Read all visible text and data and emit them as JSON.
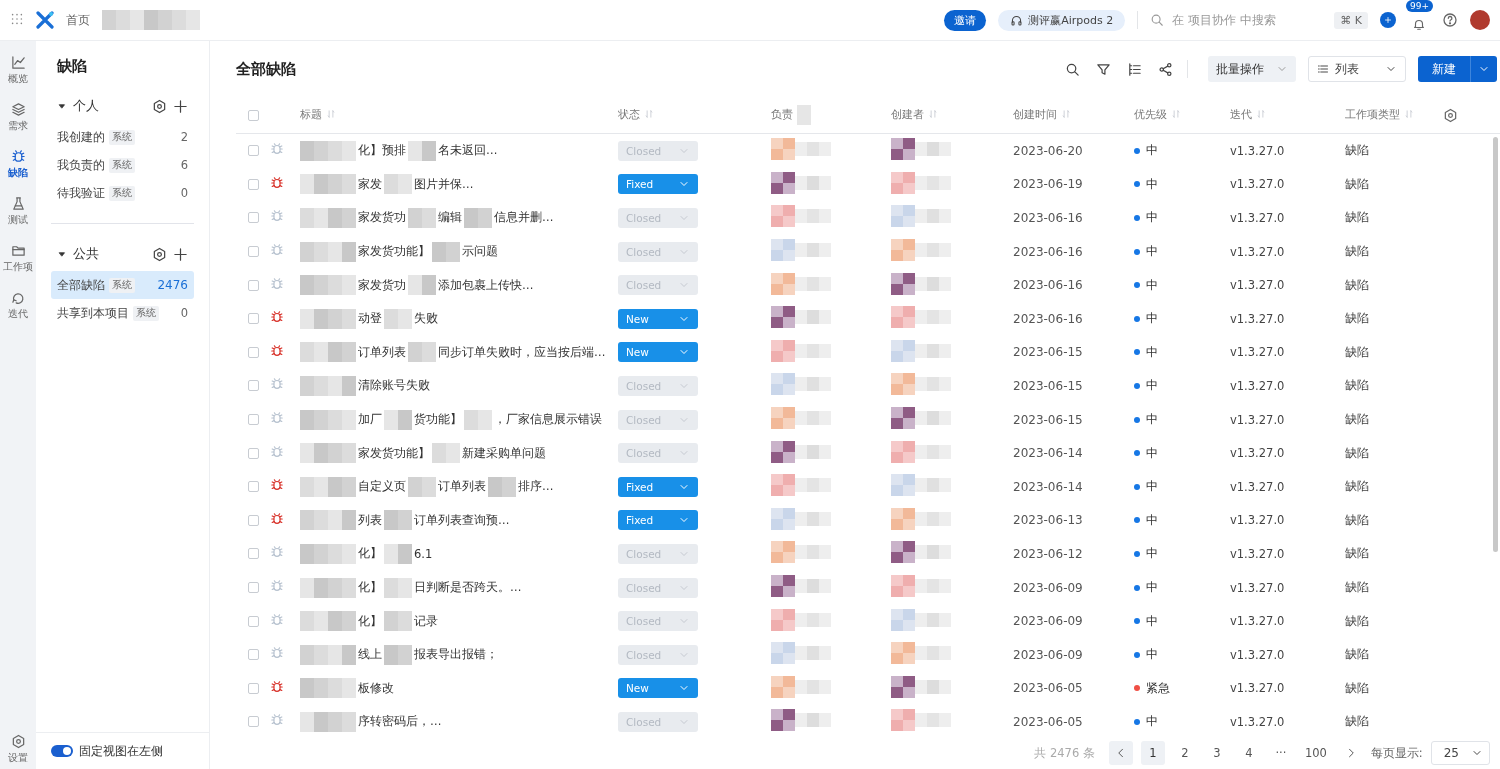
{
  "topbar": {
    "home": "首页",
    "invite": "邀请",
    "promo": "测评赢Airpods 2",
    "search_placeholder": "在 项目协作 中搜索",
    "shortcut": "⌘ K",
    "badge": "99+"
  },
  "rail": {
    "items": [
      {
        "label": "概览",
        "selected": false
      },
      {
        "label": "需求",
        "selected": false
      },
      {
        "label": "缺陷",
        "selected": true
      },
      {
        "label": "测试",
        "selected": false
      },
      {
        "label": "工作项",
        "selected": false
      },
      {
        "label": "迭代",
        "selected": false
      }
    ],
    "settings": "设置"
  },
  "sidebar": {
    "title": "缺陷",
    "sections": [
      {
        "name": "个人",
        "expanded": true,
        "items": [
          {
            "label": "我创建的",
            "tag": "系统",
            "count": "2",
            "selected": false
          },
          {
            "label": "我负责的",
            "tag": "系统",
            "count": "6",
            "selected": false
          },
          {
            "label": "待我验证",
            "tag": "系统",
            "count": "0",
            "selected": false
          }
        ]
      },
      {
        "name": "公共",
        "expanded": true,
        "items": [
          {
            "label": "全部缺陷",
            "tag": "系统",
            "count": "2476",
            "selected": true
          },
          {
            "label": "共享到本项目",
            "tag": "系统",
            "count": "0",
            "selected": false
          }
        ]
      }
    ],
    "pin_toggle": {
      "label": "固定视图在左侧",
      "on": true
    }
  },
  "main": {
    "title": "全部缺陷",
    "select_all_checked": false,
    "batch": "批量操作",
    "view": "列表",
    "create": "新建",
    "columns": [
      "标题",
      "状态",
      "负责",
      "创建者",
      "创建时间",
      "优先级",
      "迭代",
      "工作项类型"
    ],
    "rows": [
      {
        "checked": false,
        "title_parts": [
          "化】预排",
          "名未返回…"
        ],
        "open": false,
        "status": "Closed",
        "created": "2023-06-20",
        "priority": {
          "label": "中",
          "color": "#1677e5"
        },
        "iteration": "v1.3.27.0",
        "type": "缺陷"
      },
      {
        "checked": false,
        "title_parts": [
          "家发",
          "图片并保…"
        ],
        "open": true,
        "status": "Fixed",
        "created": "2023-06-19",
        "priority": {
          "label": "中",
          "color": "#1677e5"
        },
        "iteration": "v1.3.27.0",
        "type": "缺陷"
      },
      {
        "checked": false,
        "title_parts": [
          "家发货功",
          "编辑",
          "信息并删…"
        ],
        "open": false,
        "status": "Closed",
        "created": "2023-06-16",
        "priority": {
          "label": "中",
          "color": "#1677e5"
        },
        "iteration": "v1.3.27.0",
        "type": "缺陷"
      },
      {
        "checked": false,
        "title_parts": [
          "家发货功能】",
          "示问题"
        ],
        "open": false,
        "status": "Closed",
        "created": "2023-06-16",
        "priority": {
          "label": "中",
          "color": "#1677e5"
        },
        "iteration": "v1.3.27.0",
        "type": "缺陷"
      },
      {
        "checked": false,
        "title_parts": [
          "家发货功",
          "添加包裹上传快…"
        ],
        "open": false,
        "status": "Closed",
        "created": "2023-06-16",
        "priority": {
          "label": "中",
          "color": "#1677e5"
        },
        "iteration": "v1.3.27.0",
        "type": "缺陷"
      },
      {
        "checked": false,
        "title_parts": [
          "动登",
          "失败"
        ],
        "open": true,
        "status": "New",
        "created": "2023-06-16",
        "priority": {
          "label": "中",
          "color": "#1677e5"
        },
        "iteration": "v1.3.27.0",
        "type": "缺陷"
      },
      {
        "checked": false,
        "title_parts": [
          "订单列表",
          "同步订单失败时，应当按后端…"
        ],
        "open": true,
        "status": "New",
        "created": "2023-06-15",
        "priority": {
          "label": "中",
          "color": "#1677e5"
        },
        "iteration": "v1.3.27.0",
        "type": "缺陷"
      },
      {
        "checked": false,
        "title_parts": [
          "清除账号失败"
        ],
        "open": false,
        "status": "Closed",
        "created": "2023-06-15",
        "priority": {
          "label": "中",
          "color": "#1677e5"
        },
        "iteration": "v1.3.27.0",
        "type": "缺陷"
      },
      {
        "checked": false,
        "title_parts": [
          "加厂",
          "货功能】",
          "，厂家信息展示错误"
        ],
        "open": false,
        "status": "Closed",
        "created": "2023-06-15",
        "priority": {
          "label": "中",
          "color": "#1677e5"
        },
        "iteration": "v1.3.27.0",
        "type": "缺陷"
      },
      {
        "checked": false,
        "title_parts": [
          "家发货功能】",
          "新建采购单问题"
        ],
        "open": false,
        "status": "Closed",
        "created": "2023-06-14",
        "priority": {
          "label": "中",
          "color": "#1677e5"
        },
        "iteration": "v1.3.27.0",
        "type": "缺陷"
      },
      {
        "checked": false,
        "title_parts": [
          "自定义页",
          "订单列表",
          "排序…"
        ],
        "open": true,
        "status": "Fixed",
        "created": "2023-06-14",
        "priority": {
          "label": "中",
          "color": "#1677e5"
        },
        "iteration": "v1.3.27.0",
        "type": "缺陷"
      },
      {
        "checked": false,
        "title_parts": [
          "列表",
          "订单列表查询预…"
        ],
        "open": true,
        "status": "Fixed",
        "created": "2023-06-13",
        "priority": {
          "label": "中",
          "color": "#1677e5"
        },
        "iteration": "v1.3.27.0",
        "type": "缺陷"
      },
      {
        "checked": false,
        "title_parts": [
          "化】",
          "6.1"
        ],
        "open": false,
        "status": "Closed",
        "created": "2023-06-12",
        "priority": {
          "label": "中",
          "color": "#1677e5"
        },
        "iteration": "v1.3.27.0",
        "type": "缺陷"
      },
      {
        "checked": false,
        "title_parts": [
          "化】",
          "日判断是否跨天。…"
        ],
        "open": false,
        "status": "Closed",
        "created": "2023-06-09",
        "priority": {
          "label": "中",
          "color": "#1677e5"
        },
        "iteration": "v1.3.27.0",
        "type": "缺陷"
      },
      {
        "checked": false,
        "title_parts": [
          "化】",
          "记录"
        ],
        "open": false,
        "status": "Closed",
        "created": "2023-06-09",
        "priority": {
          "label": "中",
          "color": "#1677e5"
        },
        "iteration": "v1.3.27.0",
        "type": "缺陷"
      },
      {
        "checked": false,
        "title_parts": [
          "线上",
          "报表导出报错；"
        ],
        "open": false,
        "status": "Closed",
        "created": "2023-06-09",
        "priority": {
          "label": "中",
          "color": "#1677e5"
        },
        "iteration": "v1.3.27.0",
        "type": "缺陷"
      },
      {
        "checked": false,
        "title_parts": [
          "板修改"
        ],
        "open": true,
        "status": "New",
        "created": "2023-06-05",
        "priority": {
          "label": "紧急",
          "color": "#f04f45"
        },
        "iteration": "v1.3.27.0",
        "type": "缺陷"
      },
      {
        "checked": false,
        "title_parts": [
          "序转密码后，…"
        ],
        "open": false,
        "status": "Closed",
        "created": "2023-06-05",
        "priority": {
          "label": "中",
          "color": "#1677e5"
        },
        "iteration": "v1.3.27.0",
        "type": "缺陷"
      }
    ],
    "pagination": {
      "total": "共 2476 条",
      "pages": [
        {
          "label": "1",
          "selected": true
        },
        {
          "label": "2",
          "selected": false
        },
        {
          "label": "3",
          "selected": false
        },
        {
          "label": "4",
          "selected": false
        },
        {
          "label": "···",
          "selected": false
        },
        {
          "label": "100",
          "selected": false
        }
      ],
      "per_page_label": "每页显示:",
      "per_page": "25"
    }
  }
}
